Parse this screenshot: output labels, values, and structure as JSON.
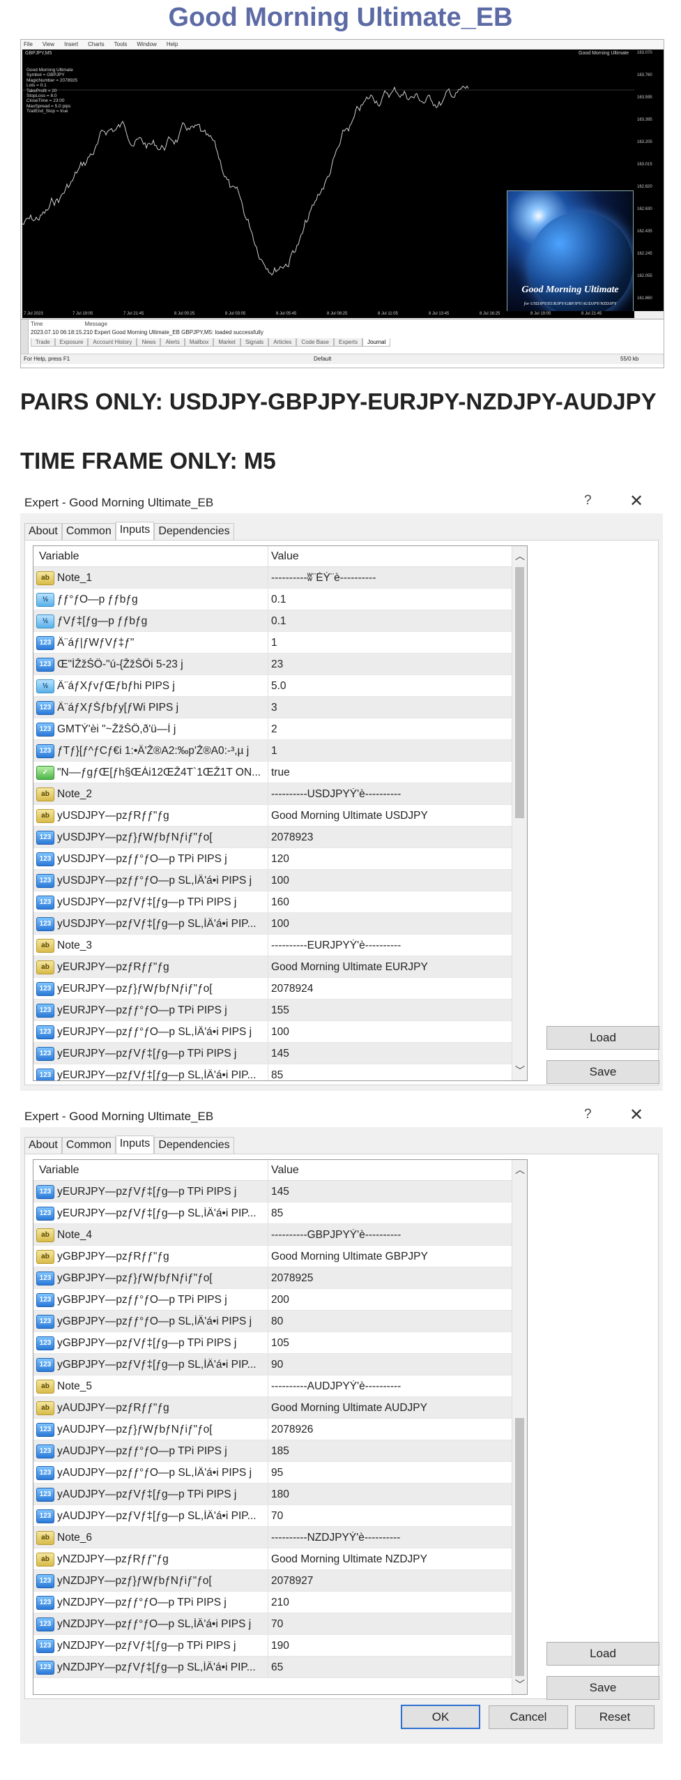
{
  "page_title": "Good Morning Ultimate_EB",
  "mt4": {
    "menu": [
      "File",
      "View",
      "Insert",
      "Charts",
      "Tools",
      "Window",
      "Help"
    ],
    "chart_title": "GBPJPY,M5",
    "ea_name": "Good Morning Ultimate",
    "info_lines": [
      "Good Morning Ultimate",
      "Symbol = GBPJPY",
      "MagicNumber = 2078925",
      "Lots = 0.1",
      "TakeProfit = 20",
      "StopLoss = 8.0",
      "CloseTime = 23:00",
      "MaxSpread = 5.0 pips",
      "TrailEnd_Stop = true"
    ],
    "price_labels": [
      "163.070",
      "163.760",
      "163.595",
      "163.395",
      "163.205",
      "163.015",
      "162.820",
      "162.630",
      "162.435",
      "162.245",
      "162.055",
      "161.860"
    ],
    "time_labels": [
      "7 Jul 2023",
      "7 Jul 19:05",
      "7 Jul 21:45",
      "8 Jul 00:25",
      "8 Jul 03:05",
      "8 Jul 05:45",
      "8 Jul 08:25",
      "8 Jul 11:05",
      "8 Jul 13:45",
      "8 Jul 16:25",
      "8 Jul 19:05",
      "8 Jul 21:45"
    ],
    "logo_title": "Good Morning Ultimate",
    "logo_pairs": "for USDJPY/EURJPY/GBPJPY/AUDJPY/NZDJPY",
    "terminal_time_header": "Time",
    "terminal_message_header": "Message",
    "terminal_row": "2023.07.10 06:18:15.210    Expert Good Morning Ultimate_EB GBPJPY,M5: loaded successfully",
    "terminal_tabs": [
      "Trade",
      "Exposure",
      "Account History",
      "News",
      "Alerts",
      "Mailbox",
      "Market",
      "Signals",
      "Articles",
      "Code Base",
      "Experts",
      "Journal"
    ],
    "status_left": "For Help, press F1",
    "status_mid": "Default",
    "status_right": "55/0 kb"
  },
  "headings": {
    "pairs": "PAIRS ONLY: USDJPY-GBPJPY-EURJPY-NZDJPY-AUDJPY",
    "timeframe": "TIME FRAME ONLY: M5"
  },
  "dialog1": {
    "title": "Expert - Good Morning Ultimate_EB",
    "help": "?",
    "close": "✕",
    "tabs": [
      "About",
      "Common",
      "Inputs",
      "Dependencies"
    ],
    "header_variable": "Variable",
    "header_value": "Value",
    "rows": [
      {
        "type": "ab",
        "var": "Note_1",
        "val": "----------ʬ¨ÉÝ¨è----------"
      },
      {
        "type": "dbl",
        "var": "ƒƒ°ƒO—p ƒƒbƒg",
        "val": "0.1"
      },
      {
        "type": "dbl",
        "var": "ƒVƒ‡[ƒg—p ƒƒbƒg",
        "val": "0.1"
      },
      {
        "type": "int",
        "var": "Ä¨áƒ|ƒWƒVƒ‡ƒ\"",
        "val": "1"
      },
      {
        "type": "int",
        "var": "Œ\"ÌŽžŠÔ-\"ú-{ŽžŠÔi 5-23 j",
        "val": "23"
      },
      {
        "type": "dbl",
        "var": "Ä¨áƒXƒvƒŒƒbƒhi PIPS j",
        "val": "5.0"
      },
      {
        "type": "int",
        "var": "Ä¨áƒXƒŠƒbƒy[ƒWi PIPS j",
        "val": "3"
      },
      {
        "type": "int",
        "var": "GMTÝ'èi \"~ŽžŠÔ,ð'ü—Í j",
        "val": "2"
      },
      {
        "type": "int",
        "var": "ƒTƒ}[ƒ^ƒCƒ€i 1:•Ä'Ž®A2:‰p'Ž®A0:-³,µ j",
        "val": "1"
      },
      {
        "type": "bool",
        "var": "\"N––ƒgƒŒ[ƒh§ŒÀi12ŒŽ4T`1ŒŽ1T ON...",
        "val": "true"
      },
      {
        "type": "ab",
        "var": "Note_2",
        "val": "----------USDJPYÝ'è----------"
      },
      {
        "type": "ab",
        "var": "yUSDJPY—pzƒRƒƒ\"ƒg",
        "val": "Good Morning Ultimate USDJPY"
      },
      {
        "type": "int",
        "var": "yUSDJPY—pzƒ}ƒWƒbƒNƒiƒ\"ƒo[",
        "val": "2078923"
      },
      {
        "type": "int",
        "var": "yUSDJPY—pzƒƒ°ƒO—p TPi PIPS j",
        "val": "120"
      },
      {
        "type": "int",
        "var": "yUSDJPY—pzƒƒ°ƒO—p SL,ÌÄ'á•i PIPS j",
        "val": "100"
      },
      {
        "type": "int",
        "var": "yUSDJPY—pzƒVƒ‡[ƒg—p TPi PIPS j",
        "val": "160"
      },
      {
        "type": "int",
        "var": "yUSDJPY—pzƒVƒ‡[ƒg—p SL,ÌÄ'á•i PIP...",
        "val": "100"
      },
      {
        "type": "ab",
        "var": "Note_3",
        "val": "----------EURJPYÝ'è----------"
      },
      {
        "type": "ab",
        "var": "yEURJPY—pzƒRƒƒ\"ƒg",
        "val": "Good Morning Ultimate EURJPY"
      },
      {
        "type": "int",
        "var": "yEURJPY—pzƒ}ƒWƒbƒNƒiƒ\"ƒo[",
        "val": "2078924"
      },
      {
        "type": "int",
        "var": "yEURJPY—pzƒƒ°ƒO—p TPi PIPS j",
        "val": "155"
      },
      {
        "type": "int",
        "var": "yEURJPY—pzƒƒ°ƒO—p SL,ÌÄ'á•i PIPS j",
        "val": "100"
      },
      {
        "type": "int",
        "var": "yEURJPY—pzƒVƒ‡[ƒg—p TPi PIPS j",
        "val": "145"
      },
      {
        "type": "int",
        "var": "yEURJPY—pzƒVƒ‡[ƒg—p SL,ÌÄ'á•i PIP...",
        "val": "85"
      }
    ],
    "load": "Load",
    "save": "Save"
  },
  "dialog2": {
    "title": "Expert - Good Morning Ultimate_EB",
    "help": "?",
    "close": "✕",
    "tabs": [
      "About",
      "Common",
      "Inputs",
      "Dependencies"
    ],
    "header_variable": "Variable",
    "header_value": "Value",
    "rows": [
      {
        "type": "int",
        "var": "yEURJPY—pzƒVƒ‡[ƒg—p TPi PIPS j",
        "val": "145"
      },
      {
        "type": "int",
        "var": "yEURJPY—pzƒVƒ‡[ƒg—p SL,ÌÄ'á•i PIP...",
        "val": "85"
      },
      {
        "type": "ab",
        "var": "Note_4",
        "val": "----------GBPJPYÝ'è----------"
      },
      {
        "type": "ab",
        "var": "yGBPJPY—pzƒRƒƒ\"ƒg",
        "val": "Good Morning Ultimate GBPJPY"
      },
      {
        "type": "int",
        "var": "yGBPJPY—pzƒ}ƒWƒbƒNƒiƒ\"ƒo[",
        "val": "2078925"
      },
      {
        "type": "int",
        "var": "yGBPJPY—pzƒƒ°ƒO—p TPi PIPS j",
        "val": "200"
      },
      {
        "type": "int",
        "var": "yGBPJPY—pzƒƒ°ƒO—p SL,ÌÄ'á•i PIPS j",
        "val": "80"
      },
      {
        "type": "int",
        "var": "yGBPJPY—pzƒVƒ‡[ƒg—p TPi PIPS j",
        "val": "105"
      },
      {
        "type": "int",
        "var": "yGBPJPY—pzƒVƒ‡[ƒg—p SL,ÌÄ'á•i PIP...",
        "val": "90"
      },
      {
        "type": "ab",
        "var": "Note_5",
        "val": "----------AUDJPYÝ'è----------"
      },
      {
        "type": "ab",
        "var": "yAUDJPY—pzƒRƒƒ\"ƒg",
        "val": "Good Morning Ultimate AUDJPY"
      },
      {
        "type": "int",
        "var": "yAUDJPY—pzƒ}ƒWƒbƒNƒiƒ\"ƒo[",
        "val": "2078926"
      },
      {
        "type": "int",
        "var": "yAUDJPY—pzƒƒ°ƒO—p TPi PIPS j",
        "val": "185"
      },
      {
        "type": "int",
        "var": "yAUDJPY—pzƒƒ°ƒO—p SL,ÌÄ'á•i PIPS j",
        "val": "95"
      },
      {
        "type": "int",
        "var": "yAUDJPY—pzƒVƒ‡[ƒg—p TPi PIPS j",
        "val": "180"
      },
      {
        "type": "int",
        "var": "yAUDJPY—pzƒVƒ‡[ƒg—p SL,ÌÄ'á•i PIP...",
        "val": "70"
      },
      {
        "type": "ab",
        "var": "Note_6",
        "val": "----------NZDJPYÝ'è----------"
      },
      {
        "type": "ab",
        "var": "yNZDJPY—pzƒRƒƒ\"ƒg",
        "val": "Good Morning Ultimate NZDJPY"
      },
      {
        "type": "int",
        "var": "yNZDJPY—pzƒ}ƒWƒbƒNƒiƒ\"ƒo[",
        "val": "2078927"
      },
      {
        "type": "int",
        "var": "yNZDJPY—pzƒƒ°ƒO—p TPi PIPS j",
        "val": "210"
      },
      {
        "type": "int",
        "var": "yNZDJPY—pzƒƒ°ƒO—p SL,ÌÄ'á•i PIPS j",
        "val": "70"
      },
      {
        "type": "int",
        "var": "yNZDJPY—pzƒVƒ‡[ƒg—p TPi PIPS j",
        "val": "190"
      },
      {
        "type": "int",
        "var": "yNZDJPY—pzƒVƒ‡[ƒg—p SL,ÌÄ'á•i PIP...",
        "val": "65"
      }
    ],
    "load": "Load",
    "save": "Save",
    "ok": "OK",
    "cancel": "Cancel",
    "reset": "Reset"
  }
}
